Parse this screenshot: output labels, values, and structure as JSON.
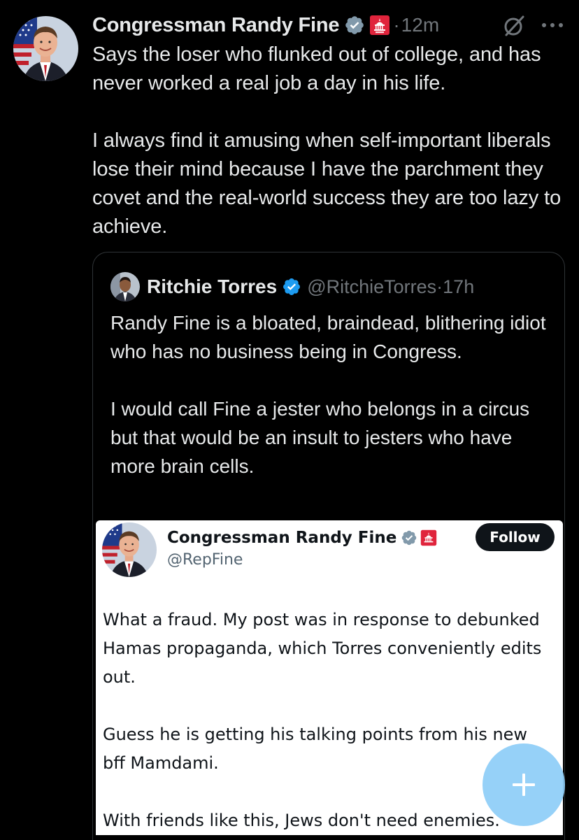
{
  "post": {
    "author_name": "Congressman Randy Fine",
    "separator": "·",
    "time": "12m",
    "text": "Says the loser who flunked out of college, and has never worked a real job a day in his life.\n\nI always find it amusing when self-important liberals lose their mind because I have the parchment they covet and the real-world success they are too lazy to achieve.",
    "avatar_icon": "congressman-portrait",
    "verified_color": "#829aab",
    "affiliation_badge": "capitol-gop-badge",
    "affiliation_color": "#e0243c",
    "menu_icon": "more-horizontal-icon",
    "grok_icon": "grok-slash-icon"
  },
  "quote": {
    "author_name": "Ritchie Torres",
    "handle": "@RitchieTorres",
    "separator": "·",
    "time": "17h",
    "text": "Randy Fine is a bloated, braindead, blithering idiot who has no business being in Congress.\n\nI would call Fine a jester who belongs in a circus but that would be an insult to jesters who have more brain cells.",
    "verified_color": "#1d9bf0",
    "embedded_screenshot": {
      "author_name": "Congressman Randy Fine",
      "handle": "@RepFine",
      "follow_label": "Follow",
      "text": "What a fraud. My post was in response to debunked Hamas propaganda, which Torres conveniently edits out.\n\nGuess he is getting his talking points from his new bff Mamdami.\n\nWith friends like this, Jews don't need enemies."
    }
  },
  "compose_button": {
    "icon": "plus-icon",
    "color": "#8ecdf8"
  },
  "theme": {
    "background": "#000000",
    "text": "#e7e9ea",
    "secondary_text": "#71767b",
    "border": "#2f3336"
  }
}
